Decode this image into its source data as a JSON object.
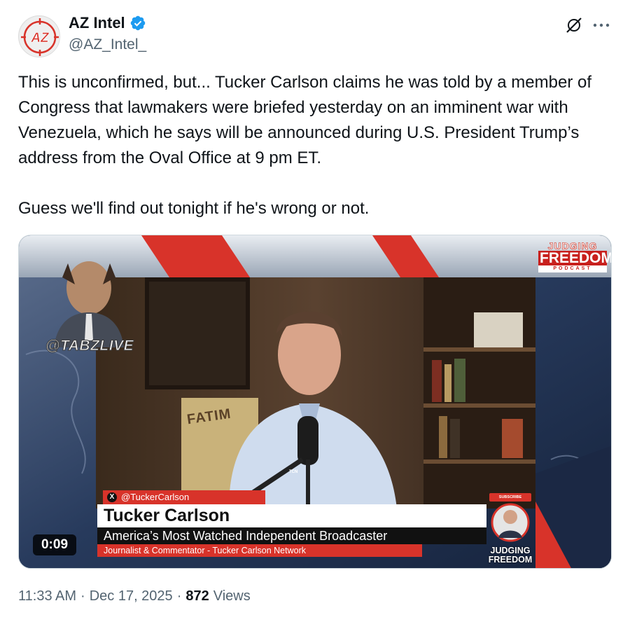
{
  "author": {
    "display_name": "AZ Intel",
    "handle": "@AZ_Intel_",
    "avatar_text": "AZ",
    "verified_icon": "verified-badge-icon",
    "brand_color": "#d8332a",
    "verified_color": "#1d9bf0"
  },
  "actions": {
    "grok_icon": "grok-icon",
    "more_icon": "more-icon"
  },
  "tweet": {
    "paragraph_1": "This is unconfirmed, but... Tucker Carlson claims he was told by a member of Congress that lawmakers were briefed yesterday on an imminent war with Venezuela, which he says will be announced during U.S. President Trump’s address from the Oval Office at 9 pm ET.",
    "paragraph_2": "Guess we'll find out tonight if he's wrong or not."
  },
  "media": {
    "duration": "0:09",
    "watermark": "@TABZLIVE",
    "logo_line1": "JUDGING",
    "logo_line2": "FREEDOM",
    "logo_line3": "PODCAST",
    "lower_third_handle": "@TuckerCarlson",
    "lower_third_name": "Tucker Carlson",
    "lower_third_title": "America’s Most Watched Independent Broadcaster",
    "lower_third_subtitle": "Journalist & Commentator - Tucker Carlson Network",
    "subscribe_label": "SUBSCRIBE",
    "bottom_logo_line1": "JUDGING",
    "bottom_logo_line2": "FREEDOM",
    "poster_text": "FATIM",
    "mic_label": "TCN"
  },
  "footer": {
    "time": "11:33 AM",
    "separator": "·",
    "date": "Dec 17, 2025",
    "views_count": "872",
    "views_label": "Views"
  }
}
